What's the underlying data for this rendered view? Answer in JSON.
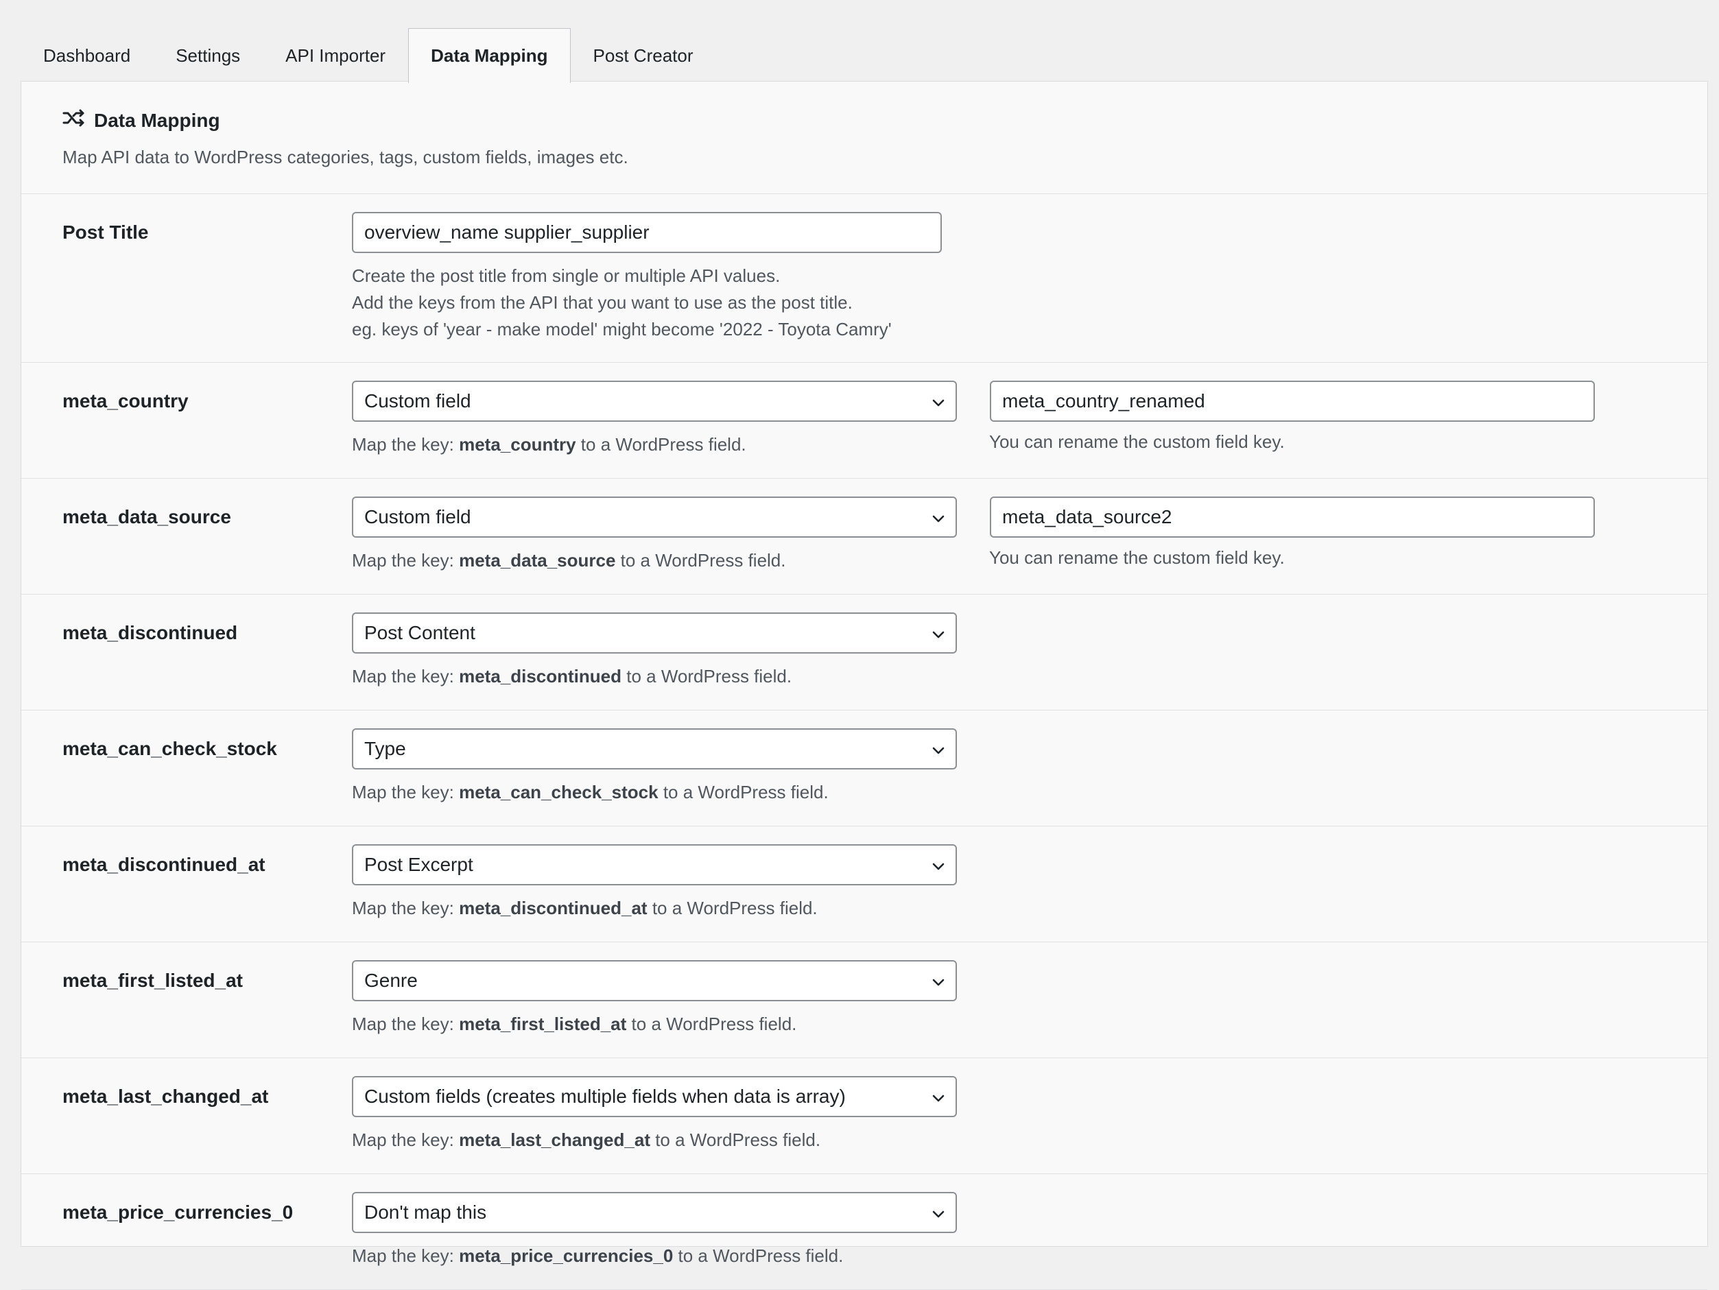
{
  "tabs": [
    {
      "label": "Dashboard",
      "active": false
    },
    {
      "label": "Settings",
      "active": false
    },
    {
      "label": "API Importer",
      "active": false
    },
    {
      "label": "Data Mapping",
      "active": true
    },
    {
      "label": "Post Creator",
      "active": false
    }
  ],
  "header": {
    "title": "Data Mapping",
    "icon": "shuffle-icon",
    "description": "Map API data to WordPress categories, tags, custom fields, images etc."
  },
  "post_title": {
    "label": "Post Title",
    "value": "overview_name supplier_supplier",
    "help": [
      "Create the post title from single or multiple API values.",
      "Add the keys from the API that you want to use as the post title.",
      "eg. keys of 'year - make model' might become '2022 - Toyota Camry'"
    ]
  },
  "help_text": {
    "prefix": "Map the key: ",
    "suffix": " to a WordPress field.",
    "rename": "You can rename the custom field key."
  },
  "mappings": [
    {
      "key": "meta_country",
      "selected": "Custom field",
      "rename": "meta_country_renamed"
    },
    {
      "key": "meta_data_source",
      "selected": "Custom field",
      "rename": "meta_data_source2"
    },
    {
      "key": "meta_discontinued",
      "selected": "Post Content",
      "rename": null
    },
    {
      "key": "meta_can_check_stock",
      "selected": "Type",
      "rename": null
    },
    {
      "key": "meta_discontinued_at",
      "selected": "Post Excerpt",
      "rename": null
    },
    {
      "key": "meta_first_listed_at",
      "selected": "Genre",
      "rename": null
    },
    {
      "key": "meta_last_changed_at",
      "selected": "Custom fields (creates multiple fields when data is array)",
      "rename": null
    },
    {
      "key": "meta_price_currencies_0",
      "selected": "Don't map this",
      "rename": null
    }
  ]
}
